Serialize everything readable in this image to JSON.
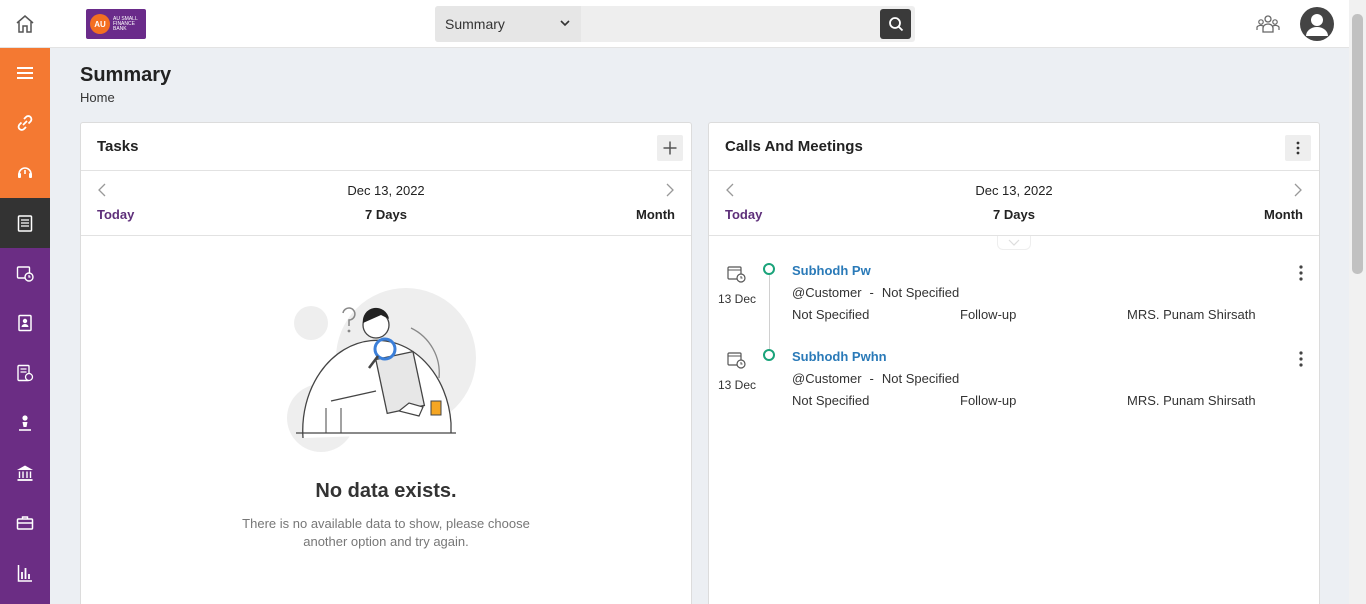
{
  "header": {
    "search_type": "Summary",
    "search_placeholder": ""
  },
  "page": {
    "title": "Summary",
    "breadcrumb": "Home"
  },
  "tasks": {
    "title": "Tasks",
    "date": "Dec 13, 2022",
    "ranges": {
      "today": "Today",
      "week": "7 Days",
      "month": "Month"
    },
    "empty_title": "No data exists.",
    "empty_desc": "There is no available data to show, please choose another option and try again."
  },
  "calls": {
    "title": "Calls And Meetings",
    "date": "Dec 13, 2022",
    "ranges": {
      "today": "Today",
      "week": "7 Days",
      "month": "Month"
    },
    "items": [
      {
        "day": "13 Dec",
        "name": "Subhodh Pw",
        "entity": "@Customer",
        "separator": "-",
        "entity_detail": "Not Specified",
        "col1": "Not Specified",
        "col2": "Follow-up",
        "col3": "MRS. Punam Shirsath"
      },
      {
        "day": "13 Dec",
        "name": "Subhodh Pwhn",
        "entity": "@Customer",
        "separator": "-",
        "entity_detail": "Not Specified",
        "col1": "Not Specified",
        "col2": "Follow-up",
        "col3": "MRS. Punam Shirsath"
      }
    ]
  },
  "colors": {
    "sidebar": "#6b2d84",
    "sidebar_orange": "#f47932",
    "sidebar_active": "#333333",
    "link": "#2a7ab8",
    "accent": "#5e2f7a",
    "timeline_dot": "#1aa37a"
  },
  "icons": {
    "home": "home-icon",
    "search": "search-icon",
    "team": "team-icon",
    "user": "user-avatar-icon",
    "sidebar": [
      "menu-icon",
      "link-icon",
      "support-icon",
      "notes-icon",
      "calendar-clock-icon",
      "contact-book-icon",
      "document-icon",
      "person-icon",
      "bank-icon",
      "briefcase-icon",
      "bar-chart-icon"
    ]
  }
}
